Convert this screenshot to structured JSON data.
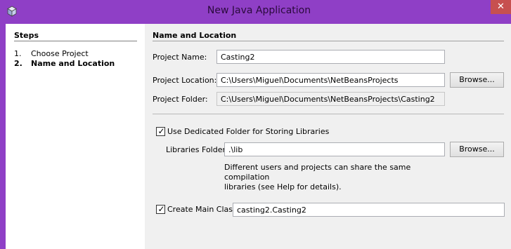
{
  "window": {
    "title": "New Java Application",
    "close_label": "✕"
  },
  "steps": {
    "heading": "Steps",
    "items": [
      {
        "number": "1.",
        "label": "Choose Project",
        "current": false
      },
      {
        "number": "2.",
        "label": "Name and Location",
        "current": true
      }
    ]
  },
  "form": {
    "heading": "Name and Location",
    "project_name_label": "Project Name:",
    "project_name_value": "Casting2",
    "project_location_label": "Project Location:",
    "project_location_value": "C:\\Users\\Miguel\\Documents\\NetBeansProjects",
    "project_folder_label": "Project Folder:",
    "project_folder_value": "C:\\Users\\Miguel\\Documents\\NetBeansProjects\\Casting2",
    "browse_label": "Browse...",
    "dedicated_folder_label": "Use Dedicated Folder for Storing Libraries",
    "dedicated_folder_checked": true,
    "libraries_folder_label": "Libraries Folder:",
    "libraries_folder_value": ".\\lib",
    "libraries_help_line1": "Different users and projects can share the same compilation",
    "libraries_help_line2": "libraries (see Help for details).",
    "create_main_class_label": "Create Main Class",
    "create_main_class_checked": true,
    "main_class_value": "casting2.Casting2"
  }
}
